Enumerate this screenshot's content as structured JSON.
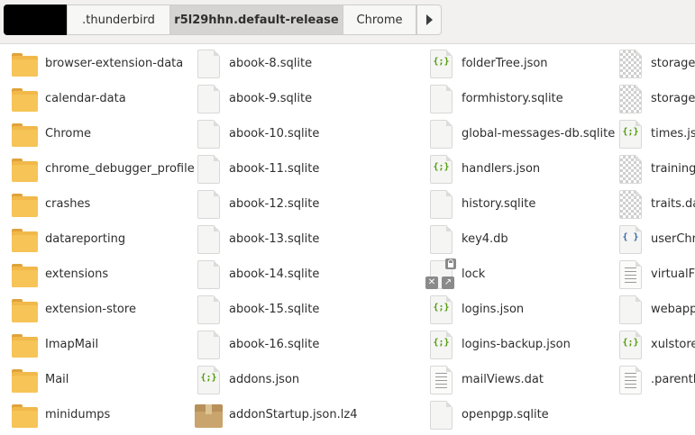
{
  "pathbar": {
    "segments": [
      ".thunderbird",
      "r5l29hhn.default-release",
      "Chrome"
    ],
    "active_segment": "r5l29hhn.default-release"
  },
  "icons": {
    "folder": "folder-icon",
    "file": "file-icon",
    "json": "json-file-icon",
    "text": "text-file-icon",
    "image": "image-file-icon",
    "archive": "archive-icon",
    "lock": "lock-icon"
  },
  "colors": {
    "folder": "#f1b84a",
    "json_glyph": "#4e9a06",
    "js_glyph": "#3465a4",
    "active_segment_bg": "#d5d4d2"
  },
  "files": {
    "col1": [
      {
        "name": "browser-extension-data",
        "type": "folder"
      },
      {
        "name": "calendar-data",
        "type": "folder"
      },
      {
        "name": "Chrome",
        "type": "folder"
      },
      {
        "name": "chrome_debugger_profile",
        "type": "folder"
      },
      {
        "name": "crashes",
        "type": "folder"
      },
      {
        "name": "datareporting",
        "type": "folder"
      },
      {
        "name": "extensions",
        "type": "folder"
      },
      {
        "name": "extension-store",
        "type": "folder"
      },
      {
        "name": "ImapMail",
        "type": "folder"
      },
      {
        "name": "Mail",
        "type": "folder"
      },
      {
        "name": "minidumps",
        "type": "folder"
      }
    ],
    "col2": [
      {
        "name": "abook-8.sqlite",
        "type": "file"
      },
      {
        "name": "abook-9.sqlite",
        "type": "file"
      },
      {
        "name": "abook-10.sqlite",
        "type": "file"
      },
      {
        "name": "abook-11.sqlite",
        "type": "file"
      },
      {
        "name": "abook-12.sqlite",
        "type": "file"
      },
      {
        "name": "abook-13.sqlite",
        "type": "file"
      },
      {
        "name": "abook-14.sqlite",
        "type": "file"
      },
      {
        "name": "abook-15.sqlite",
        "type": "file"
      },
      {
        "name": "abook-16.sqlite",
        "type": "file"
      },
      {
        "name": "addons.json",
        "type": "json"
      },
      {
        "name": "addonStartup.json.lz4",
        "type": "archive"
      }
    ],
    "col3": [
      {
        "name": "folderTree.json",
        "type": "json"
      },
      {
        "name": "formhistory.sqlite",
        "type": "file"
      },
      {
        "name": "global-messages-db.sqlite",
        "type": "file"
      },
      {
        "name": "handlers.json",
        "type": "json"
      },
      {
        "name": "history.sqlite",
        "type": "file"
      },
      {
        "name": "key4.db",
        "type": "file"
      },
      {
        "name": "lock",
        "type": "lock"
      },
      {
        "name": "logins.json",
        "type": "json"
      },
      {
        "name": "logins-backup.json",
        "type": "json"
      },
      {
        "name": "mailViews.dat",
        "type": "text"
      },
      {
        "name": "openpgp.sqlite",
        "type": "file"
      }
    ],
    "col4": [
      {
        "name": "storage-",
        "type": "image"
      },
      {
        "name": "storage-",
        "type": "image"
      },
      {
        "name": "times.jso",
        "type": "json"
      },
      {
        "name": "training",
        "type": "image"
      },
      {
        "name": "traits.da",
        "type": "image"
      },
      {
        "name": "userChro",
        "type": "js"
      },
      {
        "name": "virtualFo",
        "type": "text"
      },
      {
        "name": "webapp",
        "type": "file"
      },
      {
        "name": "xulstore",
        "type": "json"
      },
      {
        "name": ".parentlo",
        "type": "text"
      }
    ]
  }
}
